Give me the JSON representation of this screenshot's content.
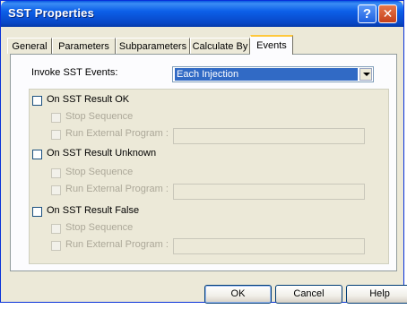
{
  "window": {
    "title": "SST Properties",
    "help_glyph": "?",
    "close_glyph": "✕"
  },
  "tabs": [
    {
      "label": "General"
    },
    {
      "label": "Parameters"
    },
    {
      "label": "Subparameters"
    },
    {
      "label": "Calculate By"
    },
    {
      "label": "Events",
      "active": true
    }
  ],
  "invoke": {
    "label": "Invoke SST Events:",
    "value": "Each Injection"
  },
  "sections": [
    {
      "label": "On SST Result OK",
      "stop": "Stop Sequence",
      "run": "Run External Program :",
      "path": ""
    },
    {
      "label": "On SST Result Unknown",
      "stop": "Stop Sequence",
      "run": "Run External Program :",
      "path": ""
    },
    {
      "label": "On SST Result False",
      "stop": "Stop Sequence",
      "run": "Run External Program :",
      "path": ""
    }
  ],
  "buttons": {
    "ok": "OK",
    "cancel": "Cancel",
    "help": "Help"
  },
  "colors": {
    "titlebar": "#0a5ae0",
    "selection": "#316ac5",
    "dialog_bg": "#ece9d8",
    "disabled_text": "#aca899"
  }
}
